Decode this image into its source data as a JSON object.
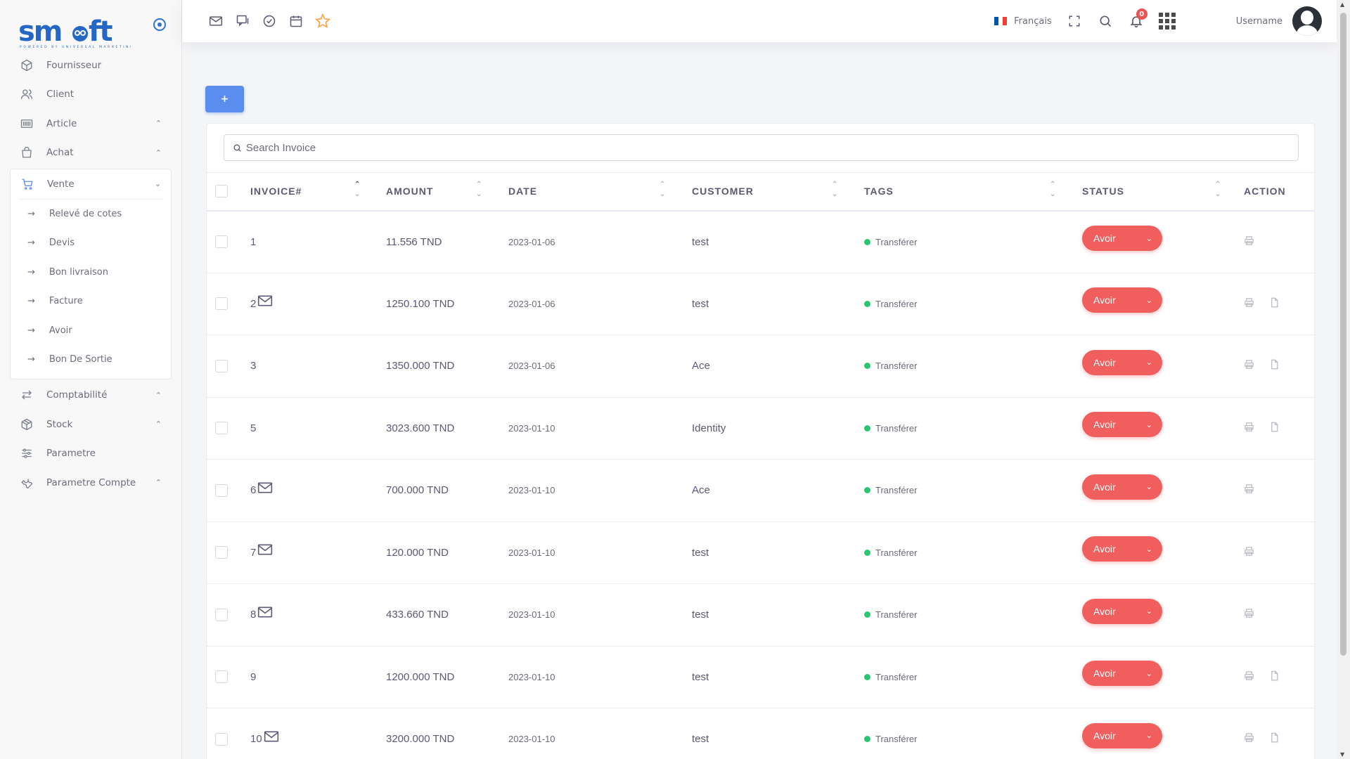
{
  "brand": {
    "logo_text": "smooft",
    "logo_sub": "POWERED BY UNIVERSAL MARKETING"
  },
  "sidebar": {
    "items_top": [
      {
        "label": "Fournisseur",
        "icon": "box-icon"
      },
      {
        "label": "Client",
        "icon": "users-icon"
      },
      {
        "label": "Article",
        "icon": "barcode-icon",
        "expandable": true
      },
      {
        "label": "Achat",
        "icon": "shopping-bag-icon",
        "expandable": true
      }
    ],
    "vente": {
      "label": "Vente",
      "icon": "cart-icon",
      "children": [
        "Relevé de cotes",
        "Devis",
        "Bon livraison",
        "Facture",
        "Avoir",
        "Bon De Sortie"
      ]
    },
    "items_bottom": [
      {
        "label": "Comptabilité",
        "icon": "transfer-icon",
        "expandable": true
      },
      {
        "label": "Stock",
        "icon": "package-icon",
        "expandable": true
      },
      {
        "label": "Parametre",
        "icon": "sliders-icon"
      },
      {
        "label": "Parametre Compte",
        "icon": "wrench-icon",
        "expandable": true
      }
    ]
  },
  "topbar": {
    "language": "Français",
    "notifications_count": "0",
    "username": "Username"
  },
  "add_button_label": "+",
  "search": {
    "placeholder": "Search Invoice"
  },
  "table": {
    "headers": [
      "INVOICE#",
      "AMOUNT",
      "DATE",
      "CUSTOMER",
      "TAGS",
      "STATUS",
      "ACTION"
    ],
    "rows": [
      {
        "invoice": "1",
        "mail": false,
        "amount": "11.556 TND",
        "date": "2023-01-06",
        "customer": "test",
        "tag": "Transférer",
        "status": "Avoir",
        "file": false
      },
      {
        "invoice": "2",
        "mail": true,
        "amount": "1250.100 TND",
        "date": "2023-01-06",
        "customer": "test",
        "tag": "Transférer",
        "status": "Avoir",
        "file": true
      },
      {
        "invoice": "3",
        "mail": false,
        "amount": "1350.000 TND",
        "date": "2023-01-06",
        "customer": "Ace",
        "tag": "Transférer",
        "status": "Avoir",
        "file": true
      },
      {
        "invoice": "5",
        "mail": false,
        "amount": "3023.600 TND",
        "date": "2023-01-10",
        "customer": "Identity",
        "tag": "Transférer",
        "status": "Avoir",
        "file": true
      },
      {
        "invoice": "6",
        "mail": true,
        "amount": "700.000 TND",
        "date": "2023-01-10",
        "customer": "Ace",
        "tag": "Transférer",
        "status": "Avoir",
        "file": false
      },
      {
        "invoice": "7",
        "mail": true,
        "amount": "120.000 TND",
        "date": "2023-01-10",
        "customer": "test",
        "tag": "Transférer",
        "status": "Avoir",
        "file": false
      },
      {
        "invoice": "8",
        "mail": true,
        "amount": "433.660 TND",
        "date": "2023-01-10",
        "customer": "test",
        "tag": "Transférer",
        "status": "Avoir",
        "file": false
      },
      {
        "invoice": "9",
        "mail": false,
        "amount": "1200.000 TND",
        "date": "2023-01-10",
        "customer": "test",
        "tag": "Transférer",
        "status": "Avoir",
        "file": true
      },
      {
        "invoice": "10",
        "mail": true,
        "amount": "3200.000 TND",
        "date": "2023-01-10",
        "customer": "test",
        "tag": "Transférer",
        "status": "Avoir",
        "file": true
      }
    ]
  },
  "colors": {
    "primary": "#5a8dee",
    "danger": "#f05e5e",
    "success": "#28c76f",
    "logo": "#2567c7"
  }
}
